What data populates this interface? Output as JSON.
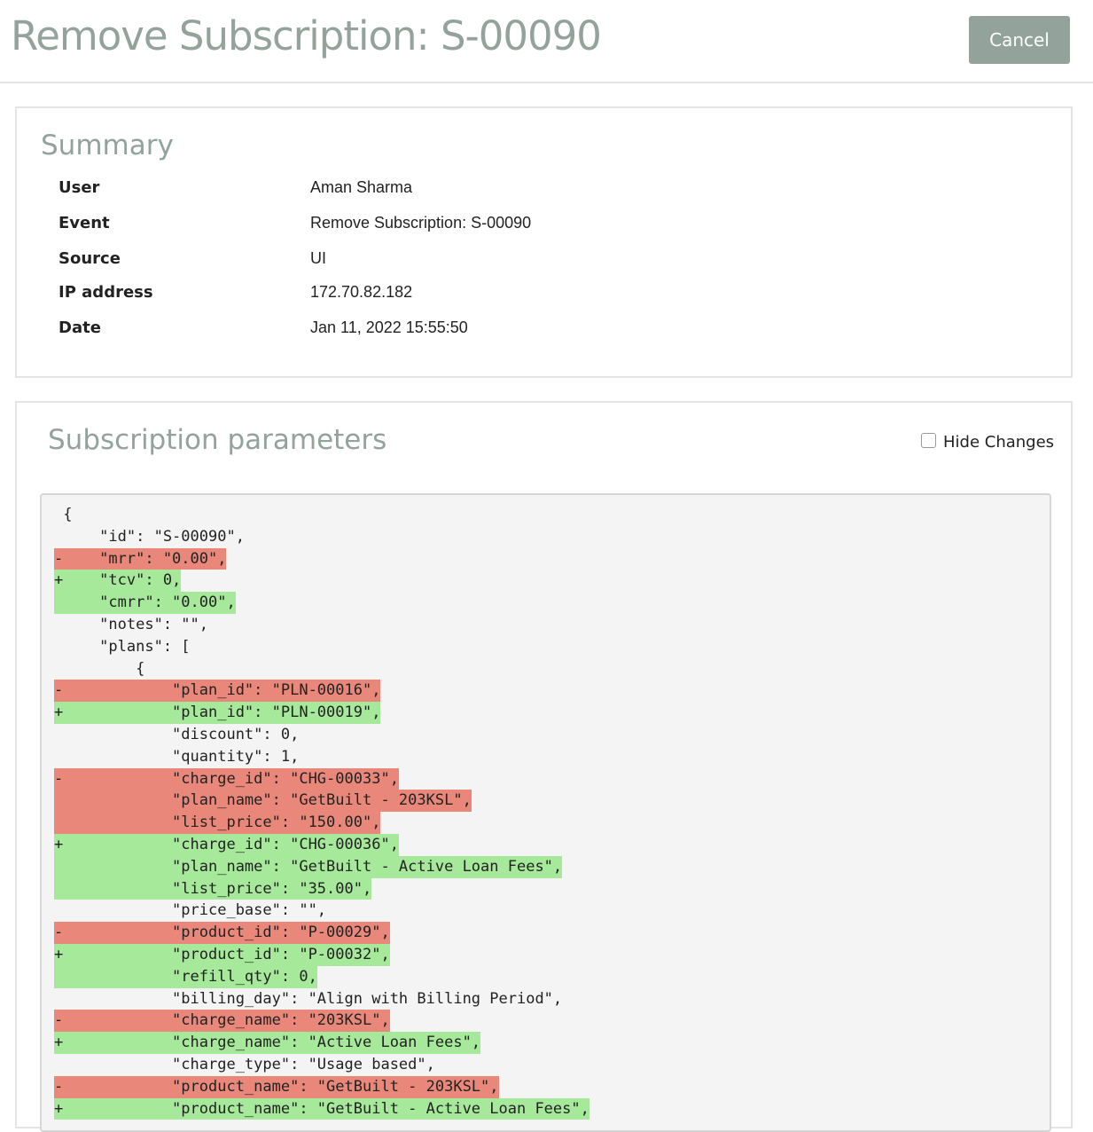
{
  "header": {
    "title": "Remove Subscription: S-00090",
    "cancel_label": "Cancel"
  },
  "summary": {
    "title": "Summary",
    "rows": [
      {
        "label": "User",
        "value": "Aman Sharma"
      },
      {
        "label": "Event",
        "value": "Remove Subscription: S-00090"
      },
      {
        "label": "Source",
        "value": "UI"
      },
      {
        "label": "IP address",
        "value": "172.70.82.182"
      },
      {
        "label": "Date",
        "value": "Jan 11, 2022 15:55:50"
      }
    ]
  },
  "params": {
    "title": "Subscription parameters",
    "hide_changes_label": "Hide Changes",
    "hide_changes_checked": false,
    "colors": {
      "removed": "#e9887a",
      "added": "#a6e99a"
    },
    "lines": [
      {
        "type": "ctx",
        "marker": "",
        "text": "{"
      },
      {
        "type": "ctx",
        "marker": "",
        "text": "    \"id\": \"S-00090\","
      },
      {
        "type": "del",
        "marker": "-",
        "text": "    \"mrr\": \"0.00\","
      },
      {
        "type": "ins",
        "marker": "+",
        "text": "    \"tcv\": 0,"
      },
      {
        "type": "ins",
        "marker": "",
        "text": "    \"cmrr\": \"0.00\","
      },
      {
        "type": "ctx",
        "marker": "",
        "text": "    \"notes\": \"\","
      },
      {
        "type": "ctx",
        "marker": "",
        "text": "    \"plans\": ["
      },
      {
        "type": "ctx",
        "marker": "",
        "text": "        {"
      },
      {
        "type": "del",
        "marker": "-",
        "text": "            \"plan_id\": \"PLN-00016\","
      },
      {
        "type": "ins",
        "marker": "+",
        "text": "            \"plan_id\": \"PLN-00019\","
      },
      {
        "type": "ctx",
        "marker": "",
        "text": "            \"discount\": 0,"
      },
      {
        "type": "ctx",
        "marker": "",
        "text": "            \"quantity\": 1,"
      },
      {
        "type": "del",
        "marker": "-",
        "text": "            \"charge_id\": \"CHG-00033\","
      },
      {
        "type": "del",
        "marker": "",
        "text": "            \"plan_name\": \"GetBuilt - 203KSL\","
      },
      {
        "type": "del",
        "marker": "",
        "text": "            \"list_price\": \"150.00\","
      },
      {
        "type": "ins",
        "marker": "+",
        "text": "            \"charge_id\": \"CHG-00036\","
      },
      {
        "type": "ins",
        "marker": "",
        "text": "            \"plan_name\": \"GetBuilt - Active Loan Fees\","
      },
      {
        "type": "ins",
        "marker": "",
        "text": "            \"list_price\": \"35.00\","
      },
      {
        "type": "ctx",
        "marker": "",
        "text": "            \"price_base\": \"\","
      },
      {
        "type": "del",
        "marker": "-",
        "text": "            \"product_id\": \"P-00029\","
      },
      {
        "type": "ins",
        "marker": "+",
        "text": "            \"product_id\": \"P-00032\","
      },
      {
        "type": "ins",
        "marker": "",
        "text": "            \"refill_qty\": 0,"
      },
      {
        "type": "ctx",
        "marker": "",
        "text": "            \"billing_day\": \"Align with Billing Period\","
      },
      {
        "type": "del",
        "marker": "-",
        "text": "            \"charge_name\": \"203KSL\","
      },
      {
        "type": "ins",
        "marker": "+",
        "text": "            \"charge_name\": \"Active Loan Fees\","
      },
      {
        "type": "ctx",
        "marker": "",
        "text": "            \"charge_type\": \"Usage based\","
      },
      {
        "type": "del",
        "marker": "-",
        "text": "            \"product_name\": \"GetBuilt - 203KSL\","
      },
      {
        "type": "ins",
        "marker": "+",
        "text": "            \"product_name\": \"GetBuilt - Active Loan Fees\","
      }
    ]
  }
}
